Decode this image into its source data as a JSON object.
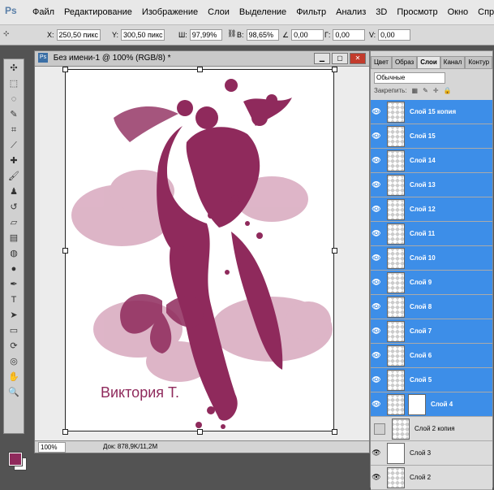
{
  "app": {
    "logo": "Ps"
  },
  "menu": [
    "Файл",
    "Редактирование",
    "Изображение",
    "Слои",
    "Выделение",
    "Фильтр",
    "Анализ",
    "3D",
    "Просмотр",
    "Окно",
    "Справка"
  ],
  "options_bar": {
    "x_label": "X:",
    "x_value": "250,50 пикс",
    "y_label": "Y:",
    "y_value": "300,50 пикс",
    "w_label": "Ш:",
    "w_value": "97,99%",
    "h_label": "В:",
    "h_value": "98,65%",
    "angle_value": "0,00",
    "h_skew_label": "Г:",
    "h_skew_value": "0,00",
    "v_skew_label": "V:",
    "v_skew_value": "0,00"
  },
  "document": {
    "title": "Без имени-1 @ 100% (RGB/8) *",
    "signature": "Виктория Т.",
    "zoom": "100%",
    "doc_info": "Док: 878,9K/11,2M"
  },
  "colors": {
    "foreground": "#8f2a5c",
    "background": "#ffffff",
    "accent": "#3d8ee8"
  },
  "panel": {
    "tabs": [
      "Цвет",
      "Образ",
      "Слои",
      "Канал",
      "Контур"
    ],
    "active_tab": "Слои",
    "blend_mode": "Обычные",
    "lock_label": "Закрепить:",
    "layers": [
      {
        "name": "Слой 15 копия",
        "selected": true
      },
      {
        "name": "Слой 15",
        "selected": true
      },
      {
        "name": "Слой 14",
        "selected": true
      },
      {
        "name": "Слой 13",
        "selected": true
      },
      {
        "name": "Слой 12",
        "selected": true
      },
      {
        "name": "Слой 11",
        "selected": true
      },
      {
        "name": "Слой 10",
        "selected": true
      },
      {
        "name": "Слой 9",
        "selected": true
      },
      {
        "name": "Слой 8",
        "selected": true
      },
      {
        "name": "Слой 7",
        "selected": true
      },
      {
        "name": "Слой 6",
        "selected": true
      },
      {
        "name": "Слой 5",
        "selected": true
      },
      {
        "name": "Слой 4",
        "selected": true
      },
      {
        "name": "Слой 2 копия",
        "selected": false
      },
      {
        "name": "Слой 3",
        "selected": false
      },
      {
        "name": "Слой 2",
        "selected": false
      }
    ]
  }
}
